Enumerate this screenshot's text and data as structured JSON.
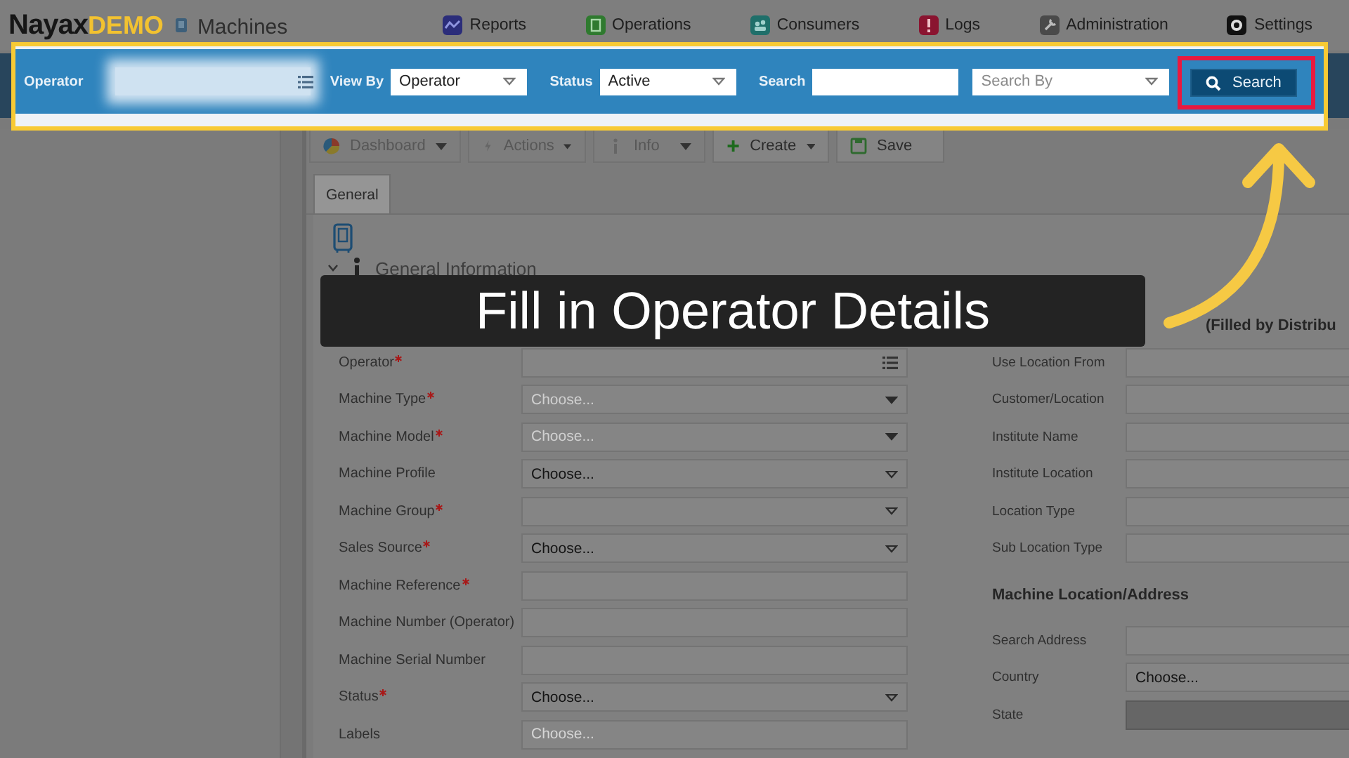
{
  "header": {
    "logo": {
      "name": "Nayax",
      "tag": "DEMO"
    },
    "page_title": "Machines",
    "nav": [
      {
        "label": "Reports",
        "kind": "chart",
        "color": "#2b2d7a"
      },
      {
        "label": "Operations",
        "kind": "clipboard",
        "color": "#2f7a2f"
      },
      {
        "label": "Consumers",
        "kind": "people",
        "color": "#1f6f6a"
      },
      {
        "label": "Logs",
        "kind": "alert",
        "color": "#8a1430"
      },
      {
        "label": "Administration",
        "kind": "wrench",
        "color": "#4a4a4a"
      },
      {
        "label": "Settings",
        "kind": "gear",
        "color": "#111111"
      }
    ]
  },
  "filter_bar": {
    "operator_label": "Operator",
    "view_by": {
      "label": "View By",
      "value": "Operator"
    },
    "status": {
      "label": "Status",
      "value": "Active"
    },
    "search": {
      "label": "Search"
    },
    "search_by": {
      "placeholder": "Search By"
    },
    "button": "Search"
  },
  "toolbar": [
    {
      "label": "Dashboard",
      "kind": "pie",
      "disabled": true,
      "dropdown": true
    },
    {
      "label": "Actions",
      "kind": "bolt",
      "disabled": true,
      "dropdown": true
    },
    {
      "label": "Info",
      "kind": "info",
      "disabled": true,
      "dropdown": true
    },
    {
      "label": "Create",
      "kind": "plus",
      "disabled": false,
      "dropdown": true
    },
    {
      "label": "Save",
      "kind": "save",
      "disabled": false,
      "dropdown": false
    }
  ],
  "tabs": [
    {
      "label": "General",
      "selected": true
    }
  ],
  "section": {
    "title": "General Information",
    "expanded": true
  },
  "left_fields": [
    {
      "label": "Operator",
      "required": true,
      "kind": "list"
    },
    {
      "label": "Machine Type",
      "required": true,
      "kind": "select",
      "placeholder": "Choose...",
      "disabled": true
    },
    {
      "label": "Machine Model",
      "required": true,
      "kind": "select",
      "placeholder": "Choose...",
      "disabled": true
    },
    {
      "label": "Machine Profile",
      "required": false,
      "kind": "select",
      "value": "Choose...",
      "disabled": false
    },
    {
      "label": "Machine Group",
      "required": true,
      "kind": "select",
      "disabled": false
    },
    {
      "label": "Sales Source",
      "required": true,
      "kind": "select",
      "value": "Choose...",
      "disabled": false
    },
    {
      "label": "Machine Reference",
      "required": true,
      "kind": "text"
    },
    {
      "label": "Machine Number (Operator)",
      "required": false,
      "kind": "text"
    },
    {
      "label": "Machine Serial Number",
      "required": false,
      "kind": "text"
    },
    {
      "label": "Status",
      "required": true,
      "kind": "select",
      "value": "Choose...",
      "disabled": false
    },
    {
      "label": "Labels",
      "required": false,
      "kind": "text",
      "placeholder": "Choose..."
    }
  ],
  "right_column": {
    "heading_fragment": "(Filled by Distribu",
    "fields": [
      {
        "label": "Use Location From",
        "disabled": false
      },
      {
        "label": "Customer/Location",
        "disabled": false
      },
      {
        "label": "Institute Name",
        "disabled": false
      },
      {
        "label": "Institute Location",
        "disabled": false
      },
      {
        "label": "Location Type",
        "disabled": false
      },
      {
        "label": "Sub Location Type",
        "disabled": false
      }
    ],
    "location_heading": "Machine Location/Address",
    "location_fields": [
      {
        "label": "Search Address",
        "disabled": false
      },
      {
        "label": "Country",
        "value": "Choose...",
        "disabled": false
      },
      {
        "label": "State",
        "disabled": true
      }
    ]
  },
  "annotation": {
    "caption": "Fill in Operator Details"
  }
}
